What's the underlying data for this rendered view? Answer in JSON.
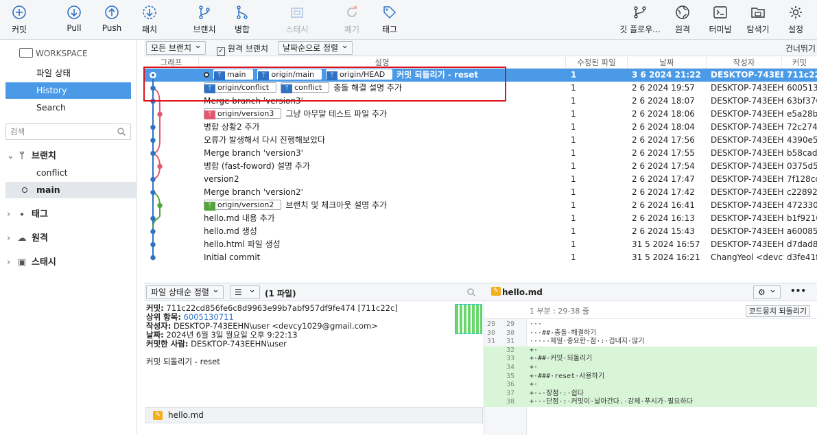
{
  "toolbar": {
    "left": [
      {
        "label": "커밋",
        "icon": "plus-circle-icon"
      },
      {
        "label": "Pull",
        "icon": "arrow-down-circle-icon"
      },
      {
        "label": "Push",
        "icon": "arrow-up-circle-icon"
      },
      {
        "label": "패치",
        "icon": "fetch-icon"
      },
      {
        "label": "브랜치",
        "icon": "branch-icon"
      },
      {
        "label": "병합",
        "icon": "merge-icon"
      },
      {
        "label": "스태시",
        "icon": "stash-icon"
      },
      {
        "label": "폐기",
        "icon": "discard-icon"
      },
      {
        "label": "태그",
        "icon": "tag-icon"
      }
    ],
    "right": [
      {
        "label": "깃 플로우...",
        "icon": "git-flow-icon"
      },
      {
        "label": "원격",
        "icon": "globe-icon"
      },
      {
        "label": "터미널",
        "icon": "terminal-icon"
      },
      {
        "label": "탐색기",
        "icon": "folder-icon"
      },
      {
        "label": "설정",
        "icon": "gear-icon"
      }
    ]
  },
  "sidebar": {
    "workspace": "WORKSPACE",
    "nav": [
      "파일 상태",
      "History",
      "Search"
    ],
    "search_placeholder": "검색",
    "branches_label": "브랜치",
    "branches": [
      "conflict",
      "main"
    ],
    "tags_label": "태그",
    "remotes_label": "원격",
    "stash_label": "스태시"
  },
  "filter": {
    "branches": "모든 브랜치",
    "remote_branches": "원격 브랜치",
    "sort": "날짜순으로 정렬",
    "skip": "건너뛰기"
  },
  "columns": [
    "그래프",
    "설명",
    "수정된 파일",
    "날짜",
    "작성자",
    "커밋"
  ],
  "commits": [
    {
      "head": true,
      "tags": [
        {
          "name": "main",
          "c": "blue"
        },
        {
          "name": "origin/main",
          "c": "blue"
        },
        {
          "name": "origin/HEAD",
          "c": "blue"
        }
      ],
      "msg": "커밋 되돌리기 - reset",
      "files": "1",
      "date": "3 6 2024 21:22",
      "author": "DESKTOP-743EEHN",
      "hash": "711c22c"
    },
    {
      "tags": [
        {
          "name": "origin/conflict",
          "c": "blue"
        },
        {
          "name": "conflict",
          "c": "blue"
        }
      ],
      "msg": "충돌 해결 설명 추가",
      "files": "1",
      "date": "2 6 2024 19:57",
      "author": "DESKTOP-743EEHN",
      "hash": "6005130"
    },
    {
      "tags": [],
      "msg": "Merge branch 'version3'",
      "files": "1",
      "date": "2 6 2024 18:07",
      "author": "DESKTOP-743EEHN",
      "hash": "63bf376"
    },
    {
      "tags": [
        {
          "name": "origin/version3",
          "c": "pink"
        }
      ],
      "msg": "그냥 아무말 테스트 파일 추가",
      "files": "1",
      "date": "2 6 2024 18:06",
      "author": "DESKTOP-743EEHN",
      "hash": "e5a28b1"
    },
    {
      "tags": [],
      "msg": "병합 상황2 추가",
      "files": "1",
      "date": "2 6 2024 18:04",
      "author": "DESKTOP-743EEHN",
      "hash": "72c2743"
    },
    {
      "tags": [],
      "msg": "오류가 발생해서 다시 진행해보았다",
      "files": "1",
      "date": "2 6 2024 17:56",
      "author": "DESKTOP-743EEHN",
      "hash": "4390e51"
    },
    {
      "tags": [],
      "msg": "Merge branch 'version3'",
      "files": "1",
      "date": "2 6 2024 17:55",
      "author": "DESKTOP-743EEHN",
      "hash": "b58cada"
    },
    {
      "tags": [],
      "msg": " 병합 (fast-foword) 설명 추가",
      "files": "1",
      "date": "2 6 2024 17:54",
      "author": "DESKTOP-743EEHN",
      "hash": "0375d5f"
    },
    {
      "tags": [],
      "msg": "version2",
      "files": "1",
      "date": "2 6 2024 17:47",
      "author": "DESKTOP-743EEHN",
      "hash": "7f128cc"
    },
    {
      "tags": [],
      "msg": "Merge branch 'version2'",
      "files": "1",
      "date": "2 6 2024 17:42",
      "author": "DESKTOP-743EEHN",
      "hash": "c228928"
    },
    {
      "tags": [
        {
          "name": "origin/version2",
          "c": "green"
        }
      ],
      "msg": "브랜치 및 체크아웃 설명 추가",
      "files": "1",
      "date": "2 6 2024 16:41",
      "author": "DESKTOP-743EEHN",
      "hash": "472330c"
    },
    {
      "tags": [],
      "msg": "hello.md 내용 추가",
      "files": "1",
      "date": "2 6 2024 16:13",
      "author": "DESKTOP-743EEHN",
      "hash": "b1f9210"
    },
    {
      "tags": [],
      "msg": "hello.md 생성",
      "files": "1",
      "date": "2 6 2024 15:43",
      "author": "DESKTOP-743EEHN",
      "hash": "a60085a"
    },
    {
      "tags": [],
      "msg": "hello.html 파일 생성",
      "files": "1",
      "date": "31 5 2024 16:57",
      "author": "DESKTOP-743EEHN",
      "hash": "d7dad84"
    },
    {
      "tags": [],
      "msg": "Initial commit",
      "files": "1",
      "date": "31 5 2024 16:21",
      "author": "ChangYeol <devcy",
      "hash": "d3fe41f"
    }
  ],
  "lower_left": {
    "sort": "파일 상태순 정렬",
    "file_count": "(1 파일)",
    "commit_label": "커밋:",
    "commit_value": "711c22cd856fe6c8d9963e99b7abf957df9fe474 [711c22c]",
    "parent_label": "상위 항목:",
    "parent_value": "6005130711",
    "author_label": "작성자:",
    "author_value": "DESKTOP-743EEHN\\user <devcy1029@gmail.com>",
    "date_label": "날짜:",
    "date_value": "2024년 6월 3일 월요일 오후 9:22:13",
    "committer_label": "커밋한 사람:",
    "committer_value": "DESKTOP-743EEHN\\user",
    "message": "커밋 되돌리기 - reset",
    "file": "hello.md"
  },
  "lower_right": {
    "file": "hello.md",
    "hunk": "1 부분 : 29-38 줄",
    "hunk_button": "코드뭉치 되돌리기",
    "more": "•••",
    "lines": [
      {
        "n1": "29",
        "n2": "29",
        "text": "···",
        "type": "ctx"
      },
      {
        "n1": "30",
        "n2": "30",
        "text": "···##·충돌·해결하기",
        "type": "ctx"
      },
      {
        "n1": "31",
        "n2": "31",
        "text": "···-·제일·중요한·점·:·겁내지·않기",
        "type": "ctx"
      },
      {
        "n1": "",
        "n2": "32",
        "text": "+·",
        "type": "add"
      },
      {
        "n1": "",
        "n2": "33",
        "text": "+·##·커밋·되돌리기",
        "type": "add"
      },
      {
        "n1": "",
        "n2": "34",
        "text": "+·",
        "type": "add"
      },
      {
        "n1": "",
        "n2": "35",
        "text": "+·###·reset·사용하기",
        "type": "add"
      },
      {
        "n1": "",
        "n2": "36",
        "text": "+·",
        "type": "add"
      },
      {
        "n1": "",
        "n2": "37",
        "text": "+·-·장점·:·쉽다",
        "type": "add"
      },
      {
        "n1": "",
        "n2": "38",
        "text": "+·-·단점·:·커밋이·날아간다.·강제·푸시가·필요하다",
        "type": "add"
      }
    ]
  }
}
